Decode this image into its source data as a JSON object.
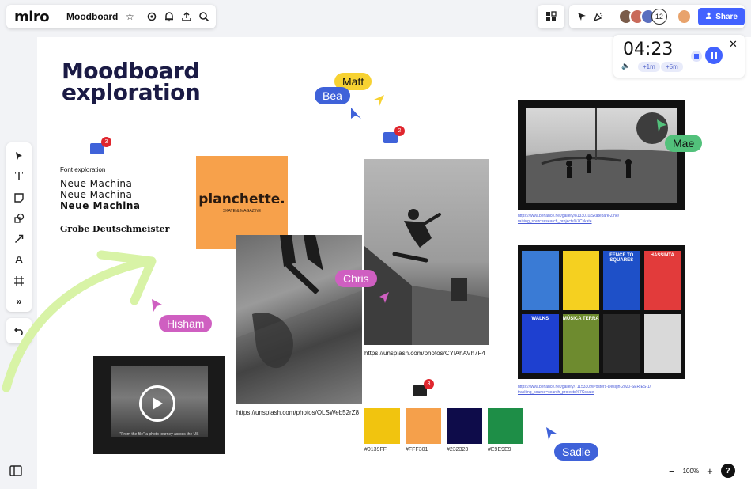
{
  "app": {
    "logo": "miro",
    "board_title": "Moodboard"
  },
  "topbar": {
    "share_label": "Share",
    "collaborator_count": "12"
  },
  "timer": {
    "time": "04:23",
    "add_1": "+1m",
    "add_5": "+5m"
  },
  "board": {
    "heading_line1": "Moodboard",
    "heading_line2": "exploration",
    "font_exploration": {
      "label": "Font exploration",
      "samples": [
        "Neue Machina",
        "Neue Machina",
        "Neue Machina",
        "Grobe Deutschmeister"
      ]
    },
    "logo_card": {
      "name": "planchette.",
      "tagline": "SKATE & MAGAZINE"
    },
    "video_caption": "\"From the file\" a photo journey across the US",
    "urls": {
      "photo_left": "https://unsplash.com/photos/OLSWeb52rZ8",
      "photo_center": "https://unsplash.com/photos/CYlAhAVh7F4",
      "photo_skatepark": "https://www.behance.net/gallery/8133010/Skatepark-Zine/ raising_source=search_projects%7Cskate",
      "posters": "https://www.behance.net/gallery/71153309/Posters-Design-2020-SERIES-1/ tracking_source=search_projects%7Cskate"
    },
    "comments": [
      {
        "count": "3"
      },
      {
        "count": "2"
      },
      {
        "count": "3"
      }
    ],
    "cursors": {
      "matt": "Matt",
      "bea": "Bea",
      "mae": "Mae",
      "chris": "Chris",
      "hisham": "Hisham",
      "sadie": "Sadie"
    },
    "swatches": [
      {
        "label": "#0139FF",
        "color": "#f1c40f"
      },
      {
        "label": "#FFF301",
        "color": "#f5a04b"
      },
      {
        "label": "#232323",
        "color": "#0e0c4a"
      },
      {
        "label": "#E9E9E9",
        "color": "#1e8e47"
      }
    ],
    "posters": [
      {
        "text": "",
        "bg": "#3a7bd5"
      },
      {
        "text": "",
        "bg": "#f5d020"
      },
      {
        "text": "FENCE TO SQUARES",
        "bg": "#1e50c8"
      },
      {
        "text": "HASSINTA",
        "bg": "#e23b3b"
      },
      {
        "text": "WALKS",
        "bg": "#1e40d0"
      },
      {
        "text": "MÚSICA TERRA",
        "bg": "#6e8b2f"
      },
      {
        "text": "",
        "bg": "#2b2b2b"
      },
      {
        "text": "",
        "bg": "#d9d9d9"
      }
    ]
  },
  "zoom": {
    "level": "100%"
  },
  "colors": {
    "accent": "#4262ff",
    "heading": "#1b1b45",
    "logo_card": "#f7a14b"
  }
}
